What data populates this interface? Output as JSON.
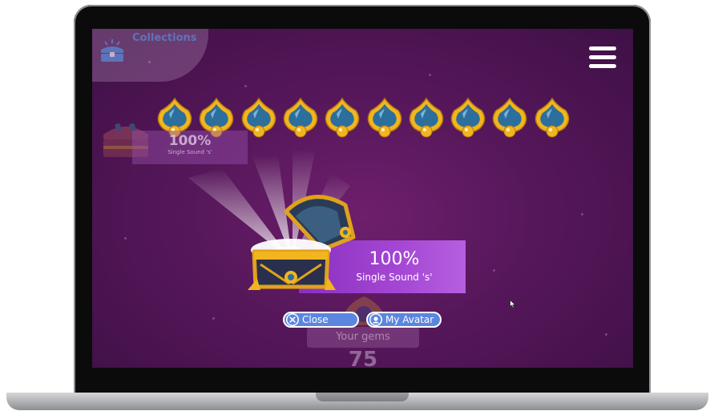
{
  "header": {
    "collections_label": "Collections"
  },
  "gems": {
    "count": 10,
    "icon": "gem-icon"
  },
  "background_badge": {
    "percent": "100%",
    "label": "Single Sound 's'"
  },
  "reward": {
    "percent": "100%",
    "label": "Single Sound 's'"
  },
  "buttons": {
    "close_label": "Close",
    "avatar_label": "My Avatar"
  },
  "gem_total": {
    "label": "Your gems",
    "count": "75"
  },
  "colors": {
    "background": "#56175a",
    "badge": "#a447d4",
    "button": "#5b86e0",
    "gold": "#f2b51f",
    "gem_blue": "#2d6f9c"
  }
}
